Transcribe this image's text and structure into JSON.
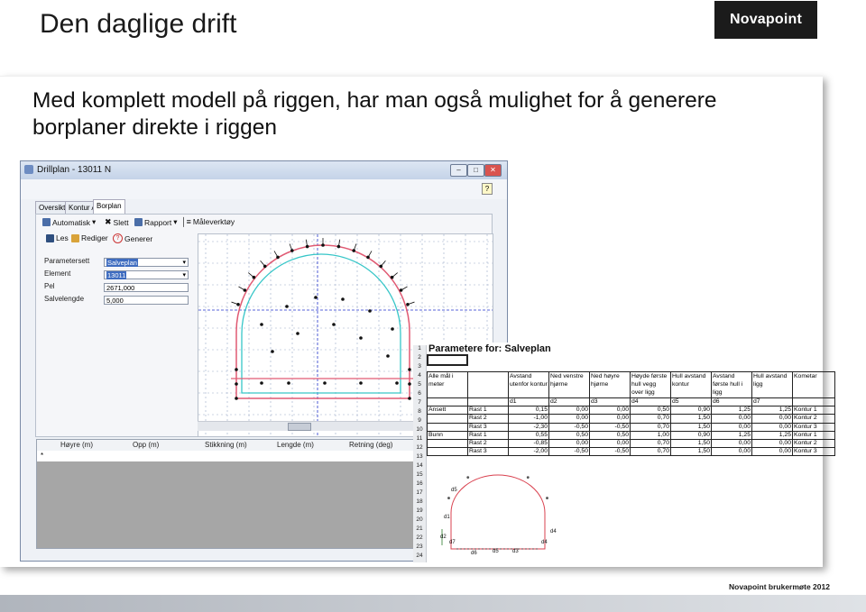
{
  "slide": {
    "title": "Den daglige drift",
    "logo": "Novapoint",
    "headline": "Med komplett modell på riggen, har man også mulighet for å generere borplaner direkte i riggen",
    "footer": "Novapoint brukermøte 2012"
  },
  "window": {
    "title": "Drillplan - 13011 N",
    "tabs": [
      "Oversikt",
      "Kontur A",
      "Borplan"
    ],
    "toolbar1": {
      "automatisk": "Automatisk",
      "slett": "Slett",
      "rapport": "Rapport",
      "maleverktoy": "Måleverktøy"
    },
    "toolbar2": {
      "les": "Les",
      "rediger": "Rediger",
      "generer": "Generer"
    },
    "form": {
      "parametersett_label": "Parametersett",
      "parametersett_value": "Salveplan",
      "element_label": "Element",
      "element_value": "13011",
      "pel_label": "Pel",
      "pel_value": "2671,000",
      "salvelengde_label": "Salvelengde",
      "salvelengde_value": "5,000"
    },
    "grid_headers": [
      "Høyre (m)",
      "Opp (m)",
      "Stikkning (m)",
      "Lengde (m)",
      "Retning (deg)"
    ],
    "grid_new_row": "*"
  },
  "sheet": {
    "title": "Parametere for: Salveplan",
    "row_numbers": [
      "1",
      "2",
      "3",
      "4",
      "5",
      "6",
      "7",
      "8",
      "9",
      "10",
      "11",
      "12",
      "13",
      "14",
      "15",
      "16",
      "17",
      "18",
      "19",
      "20",
      "21",
      "22",
      "23",
      "24"
    ],
    "header": [
      "Alle mål i meter",
      "",
      "Avstand utenfor kontur",
      "Ned venstre hjørne",
      "Ned høyre hjørne",
      "Høyde første hull vegg over ligg",
      "Hull avstand kontur",
      "Avstand første hull i ligg",
      "Hull avstand ligg",
      "Kometar"
    ],
    "subheader": [
      "",
      "",
      "d1",
      "d2",
      "d3",
      "d4",
      "d5",
      "d6",
      "d7",
      ""
    ],
    "rows": [
      [
        "Ansett",
        "Rast 1",
        "0,15",
        "0,00",
        "0,00",
        "0,50",
        "0,90",
        "1,25",
        "1,25",
        "Kontur 1"
      ],
      [
        "",
        "Rast 2",
        "-1,00",
        "0,00",
        "0,00",
        "0,70",
        "1,50",
        "0,00",
        "0,00",
        "Kontur 2"
      ],
      [
        "",
        "Rast 3",
        "-2,30",
        "-0,50",
        "-0,50",
        "0,70",
        "1,50",
        "0,00",
        "0,00",
        "Kontur 3"
      ],
      [
        "Bunn",
        "Rast 1",
        "0,55",
        "0,50",
        "0,50",
        "1,00",
        "0,90",
        "1,25",
        "1,25",
        "Kontur 1"
      ],
      [
        "",
        "Rast 2",
        "-0,85",
        "0,00",
        "0,00",
        "0,70",
        "1,50",
        "0,00",
        "0,00",
        "Kontur 2"
      ],
      [
        "",
        "Rast 3",
        "-2,00",
        "-0,50",
        "-0,50",
        "0,70",
        "1,50",
        "0,00",
        "0,00",
        "Kontur 3"
      ]
    ],
    "sketch_labels": [
      "d5",
      "d1",
      "d4",
      "d2",
      "d7",
      "d6",
      "d5",
      "d3",
      "d4"
    ]
  },
  "colors": {
    "accent": "#3e6cc0",
    "profile_cyan": "#37c6c8",
    "profile_red": "#e05a73",
    "logo_bg": "#1b1b1b"
  }
}
